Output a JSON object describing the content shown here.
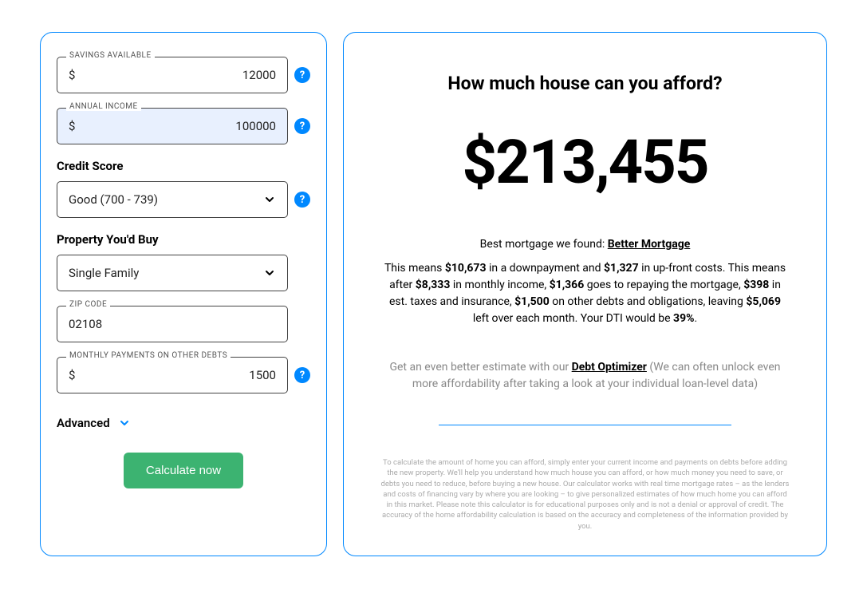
{
  "form": {
    "savings": {
      "label": "SAVINGS AVAILABLE",
      "prefix": "$",
      "value": "12000"
    },
    "income": {
      "label": "ANNUAL INCOME",
      "prefix": "$",
      "value": "100000"
    },
    "credit_score": {
      "label": "Credit Score",
      "value": "Good (700 - 739)"
    },
    "property": {
      "label": "Property You'd Buy",
      "value": "Single Family"
    },
    "zip": {
      "label": "ZIP CODE",
      "value": "02108"
    },
    "debts": {
      "label": "MONTHLY PAYMENTS ON OTHER DEBTS",
      "prefix": "$",
      "value": "1500"
    },
    "advanced_label": "Advanced",
    "calculate_label": "Calculate now"
  },
  "results": {
    "title": "How much house can you afford?",
    "price": "$213,455",
    "best_mortgage_prefix": "Best mortgage we found: ",
    "best_mortgage_name": "Better Mortgage",
    "details": {
      "pre1": "This means ",
      "downpayment": "$10,673",
      "mid1": " in a downpayment and ",
      "upfront": "$1,327",
      "mid2": " in up-front costs. This means after ",
      "monthly_income": "$8,333",
      "mid3": " in monthly income, ",
      "repay": "$1,366",
      "mid4": " goes to repaying the mortgage, ",
      "taxes": "$398",
      "mid5": " in est. taxes and insurance, ",
      "other_debts": "$1,500",
      "mid6": " on other debts and obligations, leaving ",
      "leftover": "$5,069",
      "mid7": " left over each month. Your DTI would be ",
      "dti": "39%",
      "end": "."
    },
    "optimizer_pre": "Get an even better estimate with our ",
    "optimizer_link": "Debt Optimizer",
    "optimizer_post": " (We can often unlock even more affordability after taking a look at your individual loan-level data)",
    "disclaimer": "To calculate the amount of home you can afford, simply enter your current income and payments on debts before adding the new property. We'll help you understand how much house you can afford, or how much money you need to save, or debts you need to reduce, before buying a new house. Our calculator works with real time mortgage rates – as the lenders and costs of financing vary by where you are looking – to give personalized estimates of how much home you can afford in this market. Please note this calculator is for educational purposes only and is not a denial or approval of credit. The accuracy of the home affordability calculation is based on the accuracy and completeness of the information provided by you."
  }
}
